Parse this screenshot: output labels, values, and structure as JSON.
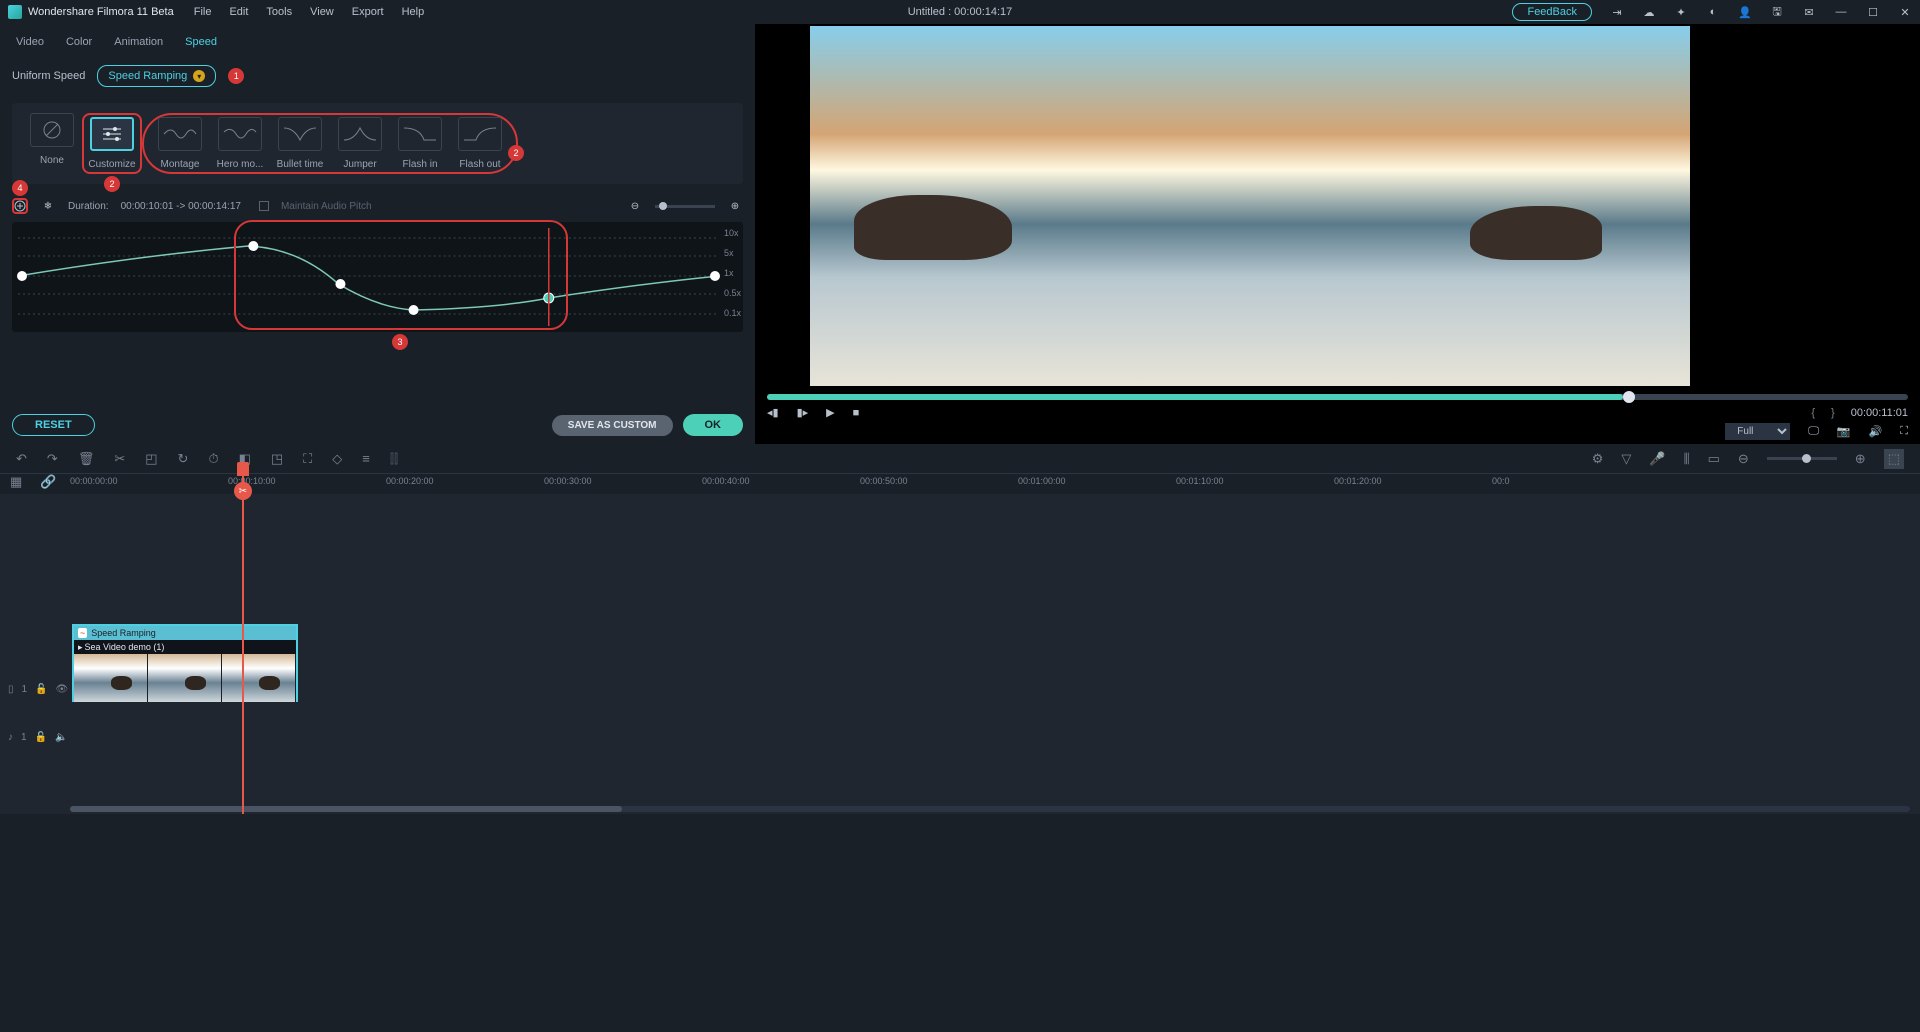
{
  "app": {
    "title": "Wondershare Filmora 11 Beta"
  },
  "menu": {
    "file": "File",
    "edit": "Edit",
    "tools": "Tools",
    "view": "View",
    "export": "Export",
    "help": "Help"
  },
  "project": {
    "title": "Untitled : 00:00:14:17"
  },
  "feedback": {
    "label": "FeedBack"
  },
  "panel": {
    "tabs": {
      "video": "Video",
      "color": "Color",
      "animation": "Animation",
      "speed": "Speed"
    },
    "subtabs": {
      "uniform": "Uniform Speed",
      "ramping": "Speed Ramping"
    },
    "presets": {
      "none": "None",
      "customize": "Customize",
      "montage": "Montage",
      "hero": "Hero mo...",
      "bullet": "Bullet time",
      "jumper": "Jumper",
      "flashin": "Flash in",
      "flashout": "Flash out"
    },
    "duration_label": "Duration:",
    "duration_value": "00:00:10:01 -> 00:00:14:17",
    "maintain_pitch": "Maintain Audio Pitch",
    "ylabels": {
      "x10": "10x",
      "x5": "5x",
      "x1": "1x",
      "x05": "0.5x",
      "x01": "0.1x"
    }
  },
  "buttons": {
    "reset": "RESET",
    "save": "SAVE AS CUSTOM",
    "ok": "OK"
  },
  "badges": {
    "b1": "1",
    "b2": "2",
    "b3": "3",
    "b4": "4"
  },
  "preview": {
    "time": "00:00:11:01",
    "braces_l": "{",
    "braces_r": "}",
    "full": "Full"
  },
  "ruler": {
    "t0": "00:00:00:00",
    "t10": "00:00:10:00",
    "t20": "00:00:20:00",
    "t30": "00:00:30:00",
    "t40": "00:00:40:00",
    "t50": "00:00:50:00",
    "t60": "00:01:00:00",
    "t70": "00:01:10:00",
    "t80": "00:01:20:00",
    "t90": "00:0"
  },
  "clip": {
    "header": "Speed Ramping",
    "name": "Sea Video demo (1)"
  },
  "track": {
    "video": "1",
    "audio": "1"
  }
}
